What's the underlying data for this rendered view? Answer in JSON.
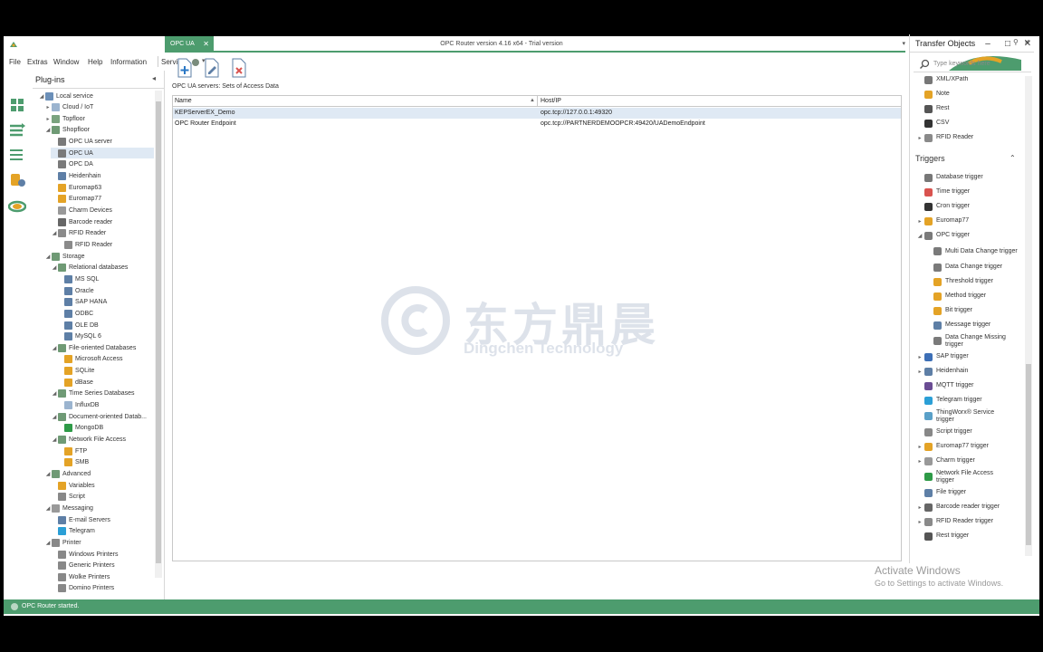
{
  "window": {
    "title": "OPC Router version 4.16 x64 - Trial version",
    "minimize": "–",
    "maximize": "□",
    "close": "✕"
  },
  "menu": [
    "File",
    "Extras",
    "Window",
    "Help",
    "Information",
    "Service"
  ],
  "plugins": {
    "title": "Plug-ins",
    "tree": [
      {
        "label": "Local service",
        "indent": 0,
        "exp": "◢",
        "color": "#6b8fb8"
      },
      {
        "label": "Cloud / IoT",
        "indent": 1,
        "exp": "▸",
        "color": "#9bb4cf"
      },
      {
        "label": "Topfloor",
        "indent": 1,
        "exp": "▸",
        "color": "#7aa37f"
      },
      {
        "label": "Shopfloor",
        "indent": 1,
        "exp": "◢",
        "color": "#6f9a75"
      },
      {
        "label": "OPC UA server",
        "indent": 2,
        "exp": "",
        "color": "#7a7a7a"
      },
      {
        "label": "OPC UA",
        "indent": 2,
        "exp": "",
        "color": "#7a7a7a"
      },
      {
        "label": "OPC DA",
        "indent": 2,
        "exp": "",
        "color": "#7a7a7a"
      },
      {
        "label": "Heidenhain",
        "indent": 2,
        "exp": "",
        "color": "#5e7fa6"
      },
      {
        "label": "Euromap63",
        "indent": 2,
        "exp": "",
        "color": "#e4a326"
      },
      {
        "label": "Euromap77",
        "indent": 2,
        "exp": "",
        "color": "#e4a326"
      },
      {
        "label": "Charm Devices",
        "indent": 2,
        "exp": "",
        "color": "#999999"
      },
      {
        "label": "Barcode reader",
        "indent": 2,
        "exp": "",
        "color": "#666666"
      },
      {
        "label": "RFID Reader",
        "indent": 2,
        "exp": "◢",
        "color": "#8a8a8a"
      },
      {
        "label": "RFID Reader",
        "indent": 3,
        "exp": "",
        "color": "#8a8a8a"
      },
      {
        "label": "Storage",
        "indent": 1,
        "exp": "◢",
        "color": "#6f9a75"
      },
      {
        "label": "Relational databases",
        "indent": 2,
        "exp": "◢",
        "color": "#6f9a75"
      },
      {
        "label": "MS SQL",
        "indent": 3,
        "exp": "",
        "color": "#5e7fa6"
      },
      {
        "label": "Oracle",
        "indent": 3,
        "exp": "",
        "color": "#5e7fa6"
      },
      {
        "label": "SAP HANA",
        "indent": 3,
        "exp": "",
        "color": "#5e7fa6"
      },
      {
        "label": "ODBC",
        "indent": 3,
        "exp": "",
        "color": "#5e7fa6"
      },
      {
        "label": "OLE DB",
        "indent": 3,
        "exp": "",
        "color": "#5e7fa6"
      },
      {
        "label": "MySQL 6",
        "indent": 3,
        "exp": "",
        "color": "#5e7fa6"
      },
      {
        "label": "File-oriented Databases",
        "indent": 2,
        "exp": "◢",
        "color": "#6f9a75"
      },
      {
        "label": "Microsoft Access",
        "indent": 3,
        "exp": "",
        "color": "#e4a326"
      },
      {
        "label": "SQLite",
        "indent": 3,
        "exp": "",
        "color": "#e4a326"
      },
      {
        "label": "dBase",
        "indent": 3,
        "exp": "",
        "color": "#e4a326"
      },
      {
        "label": "Time Series Databases",
        "indent": 2,
        "exp": "◢",
        "color": "#6f9a75"
      },
      {
        "label": "InfluxDB",
        "indent": 3,
        "exp": "",
        "color": "#9bb4cf"
      },
      {
        "label": "Document-oriented Datab...",
        "indent": 2,
        "exp": "◢",
        "color": "#6f9a75"
      },
      {
        "label": "MongoDB",
        "indent": 3,
        "exp": "",
        "color": "#2e9a47"
      },
      {
        "label": "Network File Access",
        "indent": 2,
        "exp": "◢",
        "color": "#6f9a75"
      },
      {
        "label": "FTP",
        "indent": 3,
        "exp": "",
        "color": "#e4a326"
      },
      {
        "label": "SMB",
        "indent": 3,
        "exp": "",
        "color": "#e4a326"
      },
      {
        "label": "Advanced",
        "indent": 1,
        "exp": "◢",
        "color": "#6f9a75"
      },
      {
        "label": "Variables",
        "indent": 2,
        "exp": "",
        "color": "#e4a326"
      },
      {
        "label": "Script",
        "indent": 2,
        "exp": "",
        "color": "#888888"
      },
      {
        "label": "Messaging",
        "indent": 1,
        "exp": "◢",
        "color": "#999999"
      },
      {
        "label": "E-mail Servers",
        "indent": 2,
        "exp": "",
        "color": "#5e7fa6"
      },
      {
        "label": "Telegram",
        "indent": 2,
        "exp": "",
        "color": "#2b9fd6"
      },
      {
        "label": "Printer",
        "indent": 1,
        "exp": "◢",
        "color": "#888888"
      },
      {
        "label": "Windows Printers",
        "indent": 2,
        "exp": "",
        "color": "#888888"
      },
      {
        "label": "Generic Printers",
        "indent": 2,
        "exp": "",
        "color": "#888888"
      },
      {
        "label": "Wolke Printers",
        "indent": 2,
        "exp": "",
        "color": "#888888"
      },
      {
        "label": "Domino Printers",
        "indent": 2,
        "exp": "",
        "color": "#888888"
      }
    ]
  },
  "tab": {
    "label": "OPC UA",
    "close": "✕"
  },
  "content": {
    "subtitle": "OPC UA servers: Sets of Access Data",
    "columns": [
      "Name",
      "Host/IP"
    ],
    "rows": [
      {
        "name": "KEPServerEX_Demo",
        "host": "opc.tcp://127.0.0.1:49320"
      },
      {
        "name": "OPC Router Endpoint",
        "host": "opc.tcp://PARTNERDEMOOPCR:49420/UADemoEndpoint"
      }
    ]
  },
  "transfer": {
    "title": "Transfer Objects",
    "search_placeholder": "Type keywords here",
    "items": [
      {
        "label": "XML/XPath",
        "exp": "",
        "color": "#777777"
      },
      {
        "label": "Note",
        "exp": "",
        "color": "#e4a326"
      },
      {
        "label": "Rest",
        "exp": "",
        "color": "#555555"
      },
      {
        "label": "CSV",
        "exp": "",
        "color": "#333333"
      },
      {
        "label": "RFID Reader",
        "exp": "▸",
        "color": "#8a8a8a"
      }
    ],
    "triggers_title": "Triggers",
    "triggers": [
      {
        "label": "Database trigger",
        "exp": "",
        "color": "#777777"
      },
      {
        "label": "Time trigger",
        "exp": "",
        "color": "#d9534f"
      },
      {
        "label": "Cron trigger",
        "exp": "",
        "color": "#333333"
      },
      {
        "label": "Euromap77",
        "exp": "▸",
        "color": "#e4a326"
      },
      {
        "label": "OPC trigger",
        "exp": "◢",
        "color": "#7a7a7a"
      },
      {
        "label": "Multi Data Change trigger",
        "exp": "",
        "color": "#7a7a7a",
        "indent": true
      },
      {
        "label": "Data Change trigger",
        "exp": "",
        "color": "#7a7a7a",
        "indent": true
      },
      {
        "label": "Threshold trigger",
        "exp": "",
        "color": "#e4a326",
        "indent": true
      },
      {
        "label": "Method trigger",
        "exp": "",
        "color": "#e4a326",
        "indent": true
      },
      {
        "label": "Bit trigger",
        "exp": "",
        "color": "#e4a326",
        "indent": true
      },
      {
        "label": "Message trigger",
        "exp": "",
        "color": "#5e7fa6",
        "indent": true
      },
      {
        "label": "Data Change Missing trigger",
        "exp": "",
        "color": "#7a7a7a",
        "indent": true
      },
      {
        "label": "SAP trigger",
        "exp": "▸",
        "color": "#3d6fb6"
      },
      {
        "label": "Heidenhain",
        "exp": "▸",
        "color": "#5e7fa6"
      },
      {
        "label": "MQTT trigger",
        "exp": "",
        "color": "#6a4c93"
      },
      {
        "label": "Telegram trigger",
        "exp": "",
        "color": "#2b9fd6"
      },
      {
        "label": "ThingWorx® Service trigger",
        "exp": "",
        "color": "#5aa0c8"
      },
      {
        "label": "Script trigger",
        "exp": "",
        "color": "#888888"
      },
      {
        "label": "Euromap77 trigger",
        "exp": "▸",
        "color": "#e4a326"
      },
      {
        "label": "Charm trigger",
        "exp": "▸",
        "color": "#999999"
      },
      {
        "label": "Network File Access trigger",
        "exp": "",
        "color": "#2e9a47"
      },
      {
        "label": "File trigger",
        "exp": "",
        "color": "#5e7fa6"
      },
      {
        "label": "Barcode reader trigger",
        "exp": "▸",
        "color": "#666666"
      },
      {
        "label": "RFID Reader trigger",
        "exp": "▸",
        "color": "#8a8a8a"
      },
      {
        "label": "Rest trigger",
        "exp": "",
        "color": "#555555"
      }
    ]
  },
  "status": {
    "text": "OPC Router started."
  },
  "watermark": {
    "cn": "东方鼎晨",
    "en": "Dingchen Technology"
  },
  "activate": {
    "line1": "Activate Windows",
    "line2": "Go to Settings to activate Windows."
  },
  "colors": {
    "accent": "#4d9c6e",
    "selection": "#dfe9f4"
  }
}
